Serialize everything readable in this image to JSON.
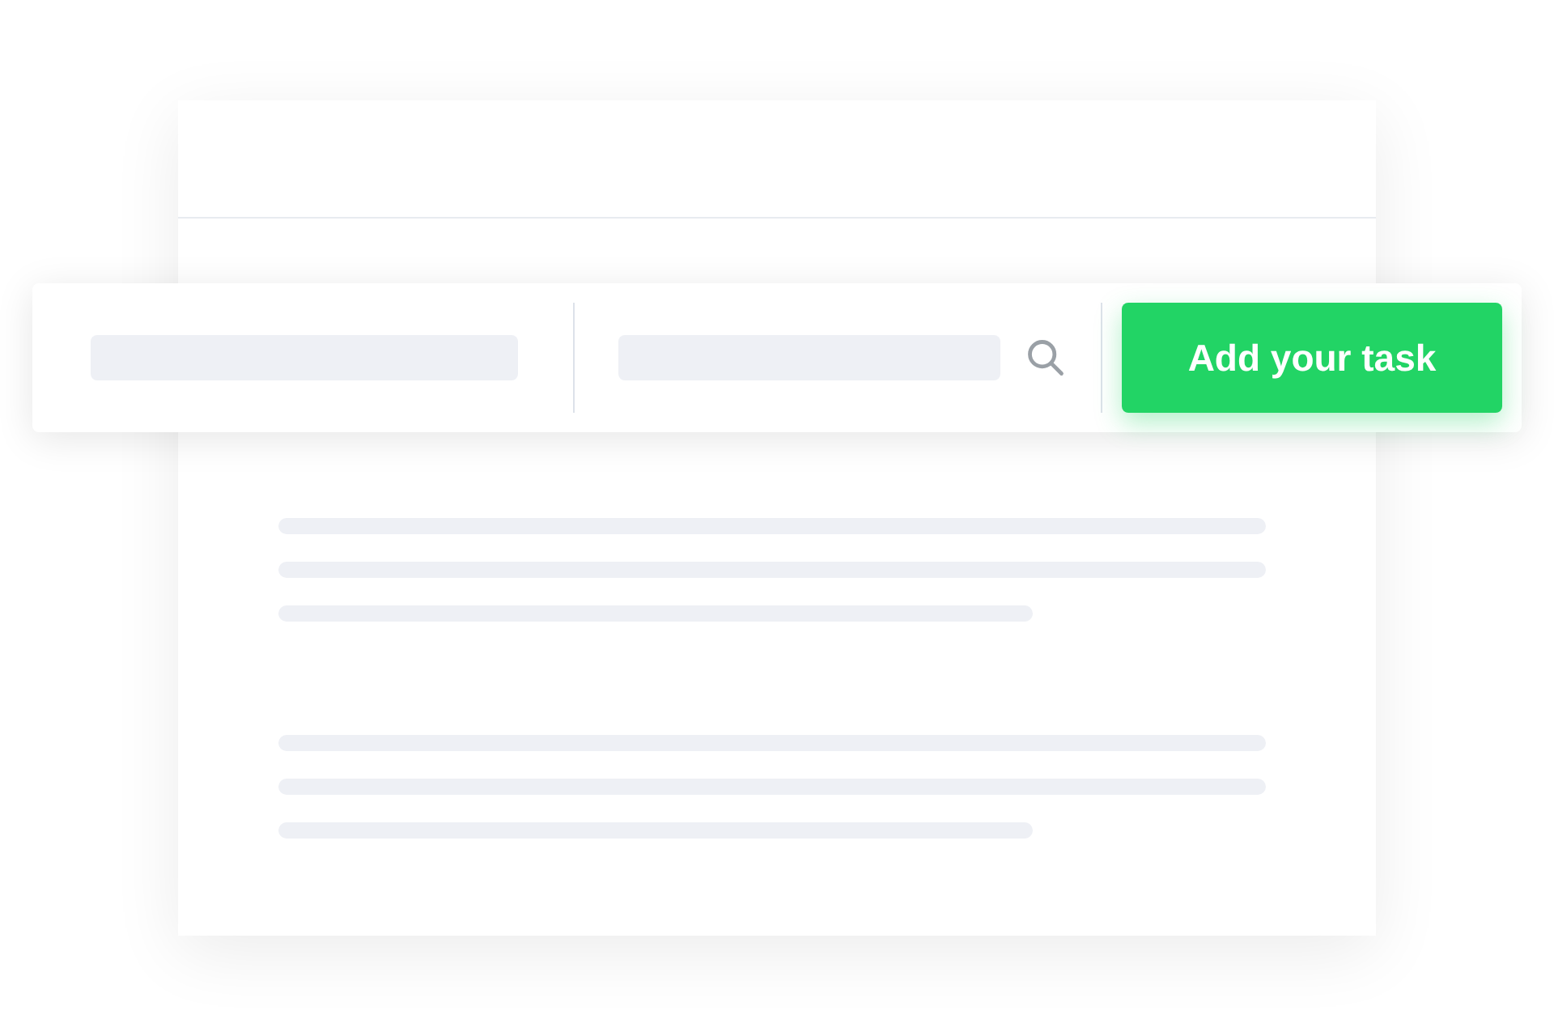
{
  "toolbar": {
    "button": {
      "label": "Add your task"
    }
  }
}
